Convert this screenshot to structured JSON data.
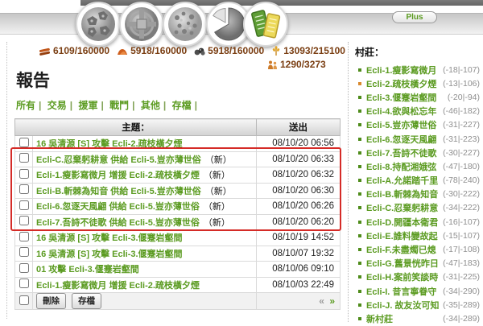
{
  "colors": {
    "accent_green": "#5b9b21",
    "highlight_red": "#d52b27",
    "active_bullet_orange": "#d9892f",
    "resource_text": "#7a3e12"
  },
  "topnav": {
    "plus_label": "Plus",
    "icons": [
      {
        "name": "village-overview-icon"
      },
      {
        "name": "village-centre-icon"
      },
      {
        "name": "map-icon"
      },
      {
        "name": "statistics-icon"
      },
      {
        "name": "reports-icon"
      }
    ]
  },
  "resources": {
    "wood": "6109/160000",
    "clay": "5918/160000",
    "iron": "5918/160000",
    "crop": "13093/215100",
    "free_crop": "1290/3273"
  },
  "page": {
    "title": "報告"
  },
  "filters": {
    "separator": "|",
    "items": [
      {
        "label": "所有"
      },
      {
        "label": "交易"
      },
      {
        "label": "援軍"
      },
      {
        "label": "戰鬥"
      },
      {
        "label": "其他"
      },
      {
        "label": "存檔"
      }
    ]
  },
  "table": {
    "header_subject": "主題：",
    "header_sent": "送出",
    "rows": [
      {
        "subject": "16 吳清源 [S] 攻擊 Ecli-2.疏枝橫夕煙",
        "new": "",
        "sent": "08/10/20 06:56"
      },
      {
        "subject": "Ecli-C.忍棄躬耕意 供給 Ecli-5.豈亦薄世俗",
        "new": "（新）",
        "sent": "08/10/20 06:33"
      },
      {
        "subject": "Ecli-1.瘦影寫微月 增援 Ecli-2.疏枝橫夕煙",
        "new": "（新）",
        "sent": "08/10/20 06:32"
      },
      {
        "subject": "Ecli-B.斬棘為知音 供給 Ecli-5.豈亦薄世俗",
        "new": "（新）",
        "sent": "08/10/20 06:30"
      },
      {
        "subject": "Ecli-6.忽逐天風翩 供給 Ecli-5.豈亦薄世俗",
        "new": "（新）",
        "sent": "08/10/20 06:26"
      },
      {
        "subject": "Ecli-7.吾詩不徒歌 供給 Ecli-5.豈亦薄世俗",
        "new": "（新）",
        "sent": "08/10/20 06:20"
      },
      {
        "subject": "16 吳清源 [S] 攻擊 Ecli-3.偃蹇岩壑間",
        "new": "",
        "sent": "08/10/19 14:52"
      },
      {
        "subject": "16 吳清源 [S] 攻擊 Ecli-3.偃蹇岩壑間",
        "new": "",
        "sent": "08/10/07 19:32"
      },
      {
        "subject": "01 攻擊 Ecli-3.偃蹇岩壑間",
        "new": "",
        "sent": "08/10/06 09:10"
      },
      {
        "subject": "Ecli-1.瘦影寫微月 增援 Ecli-2.疏枝橫夕煙",
        "new": "",
        "sent": "08/10/03 22:49"
      }
    ],
    "footer": {
      "delete_label": "刪除",
      "archive_label": "存檔",
      "prev": "«",
      "next": "»"
    }
  },
  "sidebar": {
    "title": "村莊：",
    "villages": [
      {
        "name": "Ecli-1.瘦影寫微月",
        "coords": "(-18|-107)",
        "active": false
      },
      {
        "name": "Ecli-2.疏枝橫夕煙",
        "coords": "(-13|-106)",
        "active": true
      },
      {
        "name": "Ecli-3.偃蹇岩壑間",
        "coords": "(-20|-94)",
        "active": false
      },
      {
        "name": "Ecli-4.欲與松忘年",
        "coords": "(-46|-182)",
        "active": false
      },
      {
        "name": "Ecli-5.豈亦薄世俗",
        "coords": "(-31|-227)",
        "active": false
      },
      {
        "name": "Ecli-6.忽逐天風翩",
        "coords": "(-31|-223)",
        "active": false
      },
      {
        "name": "Ecli-7.吾詩不徒歌",
        "coords": "(-30|-227)",
        "active": false
      },
      {
        "name": "Ecli-8.持配湘娥弦",
        "coords": "(-47|-180)",
        "active": false
      },
      {
        "name": "Ecli-A.允諾踏千里",
        "coords": "(-78|-240)",
        "active": false
      },
      {
        "name": "Ecli-B.斬棘為知音",
        "coords": "(-30|-222)",
        "active": false
      },
      {
        "name": "Ecli-C.忍棄躬耕意",
        "coords": "(-34|-222)",
        "active": false
      },
      {
        "name": "Ecli-D.開疆本衛君",
        "coords": "(-16|-107)",
        "active": false
      },
      {
        "name": "Ecli-E.誰料變故起",
        "coords": "(-15|-107)",
        "active": false
      },
      {
        "name": "Ecli-F.未盡燭已熄",
        "coords": "(-17|-108)",
        "active": false
      },
      {
        "name": "Ecli-G.舊景恍昨日",
        "coords": "(-47|-183)",
        "active": false
      },
      {
        "name": "Ecli-H.案前笑談時",
        "coords": "(-31|-225)",
        "active": false
      },
      {
        "name": "Ecli-I. 昔言寧眷守",
        "coords": "(-34|-290)",
        "active": false
      },
      {
        "name": "Ecli-J. 故友汝可知",
        "coords": "(-35|-289)",
        "active": false
      },
      {
        "name": "新村莊",
        "coords": "(-34|-289)",
        "active": false
      }
    ]
  }
}
